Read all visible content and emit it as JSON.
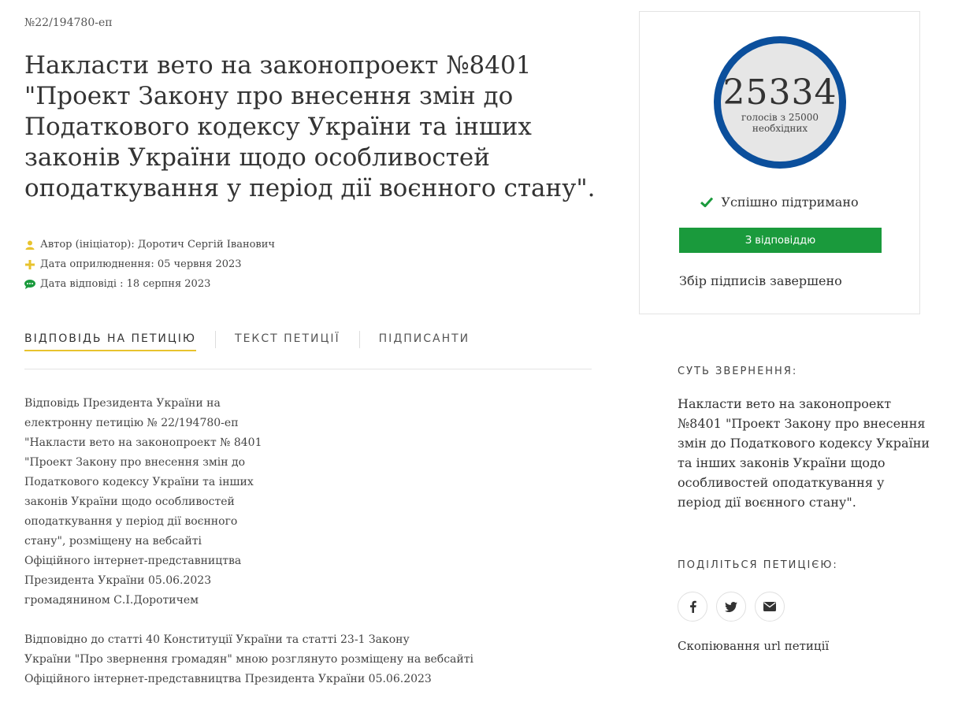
{
  "petition": {
    "number": "№22/194780-еп",
    "title": "Накласти вето на законопроект №8401 \"Проект Закону про внесення змін до Податкового кодексу України та інших законів України щодо особливостей оподаткування у період дії воєнного стану\".",
    "author": "Автор (ініціатор): Доротич Сергій Іванович",
    "published": "Дата оприлюднення: 05 червня 2023",
    "answered": "Дата відповіді : 18 серпня 2023"
  },
  "tabs": [
    {
      "label": "ВІДПОВІДЬ НА ПЕТИЦІЮ",
      "active": true
    },
    {
      "label": "ТЕКСТ ПЕТИЦІЇ",
      "active": false
    },
    {
      "label": "ПІДПИСАНТИ",
      "active": false
    }
  ],
  "answer": {
    "paragraph1": "Відповідь Президента України на\nелектронну петицію № 22/194780-еп\n\"Накласти вето на законопроект № 8401\n\"Проект Закону про внесення змін до\nПодаткового кодексу України та інших\nзаконів України щодо особливостей\nоподаткування у період дії воєнного\nстану\", розміщену на вебсайті\nОфіційного інтернет-представництва\nПрезидента України 05.06.2023\nгромадянином С.І.Доротичем",
    "paragraph2": "Відповідно до статті 40 Конституції України та статті 23-1 Закону\nУкраїни \"Про звернення громадян\" мною розглянуто розміщену на вебсайті\nОфіційного інтернет-представництва Президента України 05.06.2023"
  },
  "card": {
    "votes": "25334",
    "votes_label_line1": "голосів з 25000",
    "votes_label_line2": "необхідних",
    "votes_fraction_of_goal": 1.0134,
    "status": "Успішно підтримано",
    "answer_button": "З відповіддю",
    "collection_status": "Збір підписів завершено"
  },
  "sidebar": {
    "summary_heading": "СУТЬ ЗВЕРНЕННЯ:",
    "summary_text": "Накласти вето на законопроект №8401 \"Проект Закону про внесення змін до Податкового кодексу України та інших законів України щодо особливостей оподаткування у період дії воєнного стану\".",
    "share_heading": "ПОДІЛІТЬСЯ ПЕТИЦІЄЮ:",
    "share_icons": [
      "facebook-icon",
      "twitter-icon",
      "email-icon"
    ],
    "copy_url": "Скопіювання url петиції"
  },
  "colors": {
    "circle_border": "#0b4f9c",
    "circle_fill": "#e6e6e6",
    "button_green": "#1a9a3c",
    "tab_underline": "#e8c32e",
    "author_icon": "#e8c32e",
    "published_icon": "#e8c32e",
    "answered_icon": "#1a9a3c",
    "check_icon": "#1a9a3c"
  }
}
